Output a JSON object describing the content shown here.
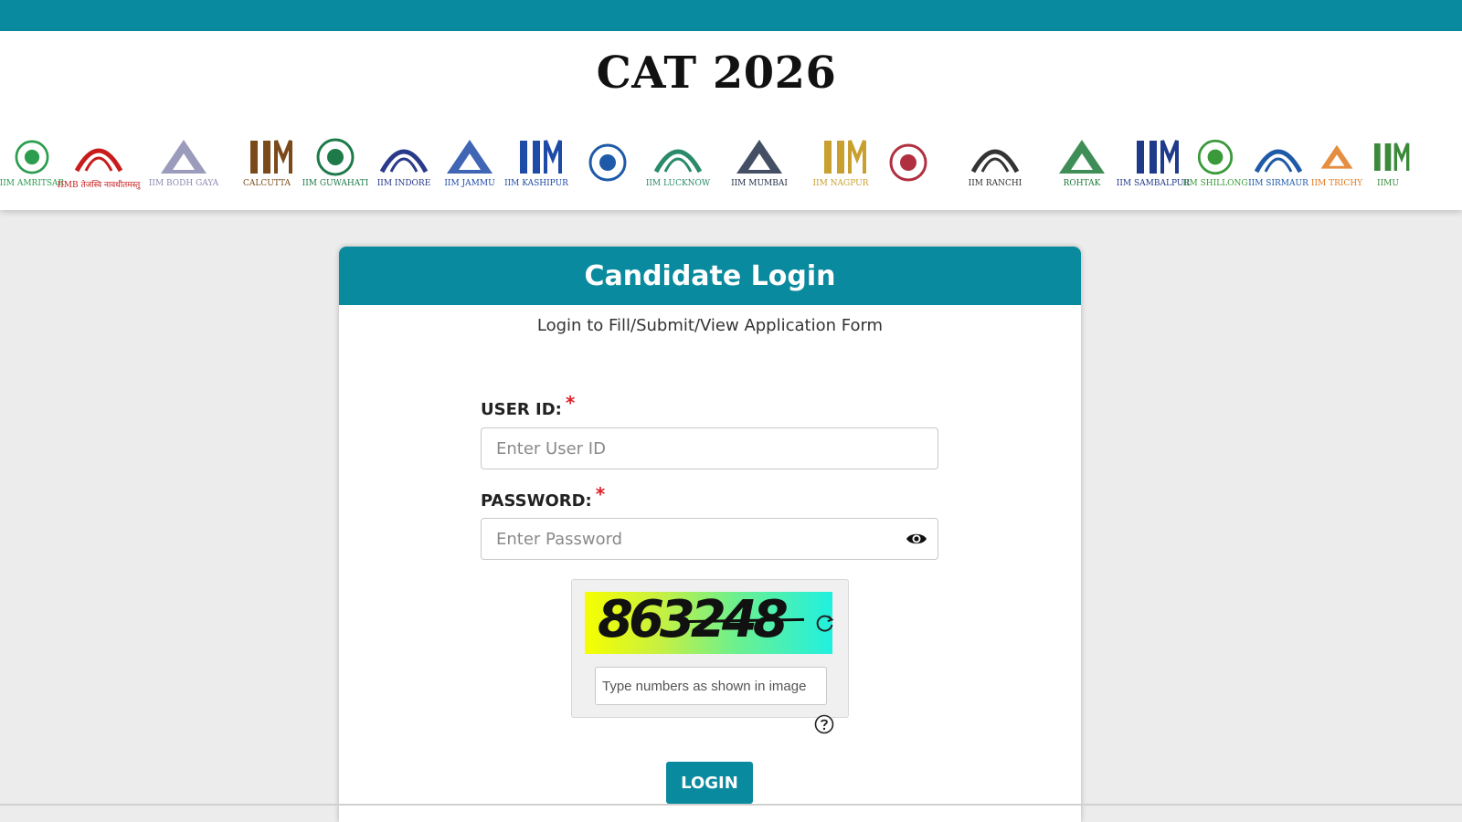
{
  "header": {
    "title": "CAT 2026",
    "logos": [
      {
        "name": "IIM",
        "sub": "AMRITSAR"
      },
      {
        "name": "IIMB",
        "sub": "तेजस्वि नावधीतमस्तु"
      },
      {
        "name": "IIM BODH GAYA",
        "sub": ""
      },
      {
        "name": "",
        "sub": "CALCUTTA"
      },
      {
        "name": "IIM",
        "sub": "GUWAHATI"
      },
      {
        "name": "",
        "sub": "IIM INDORE"
      },
      {
        "name": "IIM",
        "sub": "JAMMU"
      },
      {
        "name": "IIM KASHIPUR",
        "sub": ""
      },
      {
        "name": "",
        "sub": ""
      },
      {
        "name": "IIM",
        "sub": "LUCKNOW"
      },
      {
        "name": "IIM",
        "sub": "MUMBAI"
      },
      {
        "name": "IIM NAGPUR",
        "sub": ""
      },
      {
        "name": "",
        "sub": ""
      },
      {
        "name": "IIM",
        "sub": "RANCHI"
      },
      {
        "name": "",
        "sub": "ROHTAK"
      },
      {
        "name": "IIM",
        "sub": "SAMBALPUR"
      },
      {
        "name": "IIM",
        "sub": "SHILLONG"
      },
      {
        "name": "IIM SIRMAUR",
        "sub": ""
      },
      {
        "name": "IIM",
        "sub": "TRICHY"
      },
      {
        "name": "IIMU",
        "sub": ""
      }
    ]
  },
  "login": {
    "title": "Candidate Login",
    "subtitle": "Login to Fill/Submit/View Application Form",
    "user_id_label": "USER ID:",
    "user_id_placeholder": "Enter User ID",
    "password_label": "PASSWORD:",
    "password_placeholder": "Enter Password",
    "required_mark": "*",
    "captcha_value": "863248",
    "captcha_placeholder": "Type numbers as shown in image",
    "login_button": "LOGIN"
  },
  "colors": {
    "brand": "#0a8a9e",
    "required": "#e0202a"
  }
}
